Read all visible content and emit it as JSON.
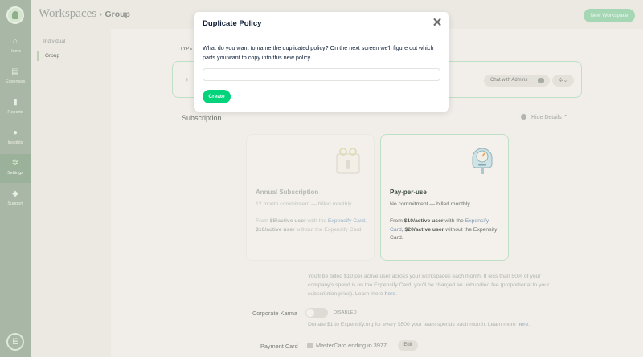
{
  "nav": {
    "items": [
      {
        "label": "Home",
        "icon": "house-icon"
      },
      {
        "label": "Expenses",
        "icon": "receipt-icon"
      },
      {
        "label": "Reports",
        "icon": "document-icon"
      },
      {
        "label": "Insights",
        "icon": "lightbulb-icon"
      },
      {
        "label": "Settings",
        "icon": "gear-icon"
      },
      {
        "label": "Support",
        "icon": "chat-bubble-icon"
      }
    ],
    "active": "Settings",
    "logo_letter": "E"
  },
  "header": {
    "section": "Workspaces",
    "current": "Group",
    "new_workspace_label": "New Workspace"
  },
  "subnav": {
    "items": [
      "Individual",
      "Group"
    ],
    "active": "Group"
  },
  "policy": {
    "type_label": "TYPE",
    "chat_label": "Chat with Admins"
  },
  "subscription": {
    "title": "Subscription",
    "hide_details": "Hide Details",
    "annual": {
      "title": "Annual Subscription",
      "commitment": "12 month commitment — billed monthly",
      "price_prefix": "From ",
      "price_bold": "$5/active user",
      "price_mid": " with the ",
      "card_link": "Expensify Card",
      "price_bold2": "$10/active user",
      "price_suffix": "without the Expensify Card."
    },
    "ppu": {
      "title": "Pay-per-use",
      "commitment": "No commitment — billed monthly",
      "price_prefix": "From ",
      "price_bold": "$10/active user",
      "price_mid": " with the ",
      "card_link": "Expensify Card",
      "price_bold2": "$20/active user",
      "price_suffix": "without the Expensify Card."
    },
    "billing_text": "You'll be billed $10 per active user across your workspaces each month. If less than 50% of your company's spend is on the Expensify Card, you'll be charged an unbundled fee (proportional to your subscription price). Learn more",
    "billing_link": "here"
  },
  "karma": {
    "label": "Corporate Karma",
    "state": "DISABLED",
    "text": "Donate $1 to Expensify.org for every $500 your team spends each month. Learn more",
    "link": "here"
  },
  "payment": {
    "label": "Payment Card",
    "card": "MasterCard ending in 3977",
    "edit_label": "Edit"
  },
  "modal": {
    "title": "Duplicate Policy",
    "close_glyph": "✕",
    "text": "What do you want to name the duplicated policy? On the next screen we'll figure out which parts you want to copy into this new policy.",
    "input_value": "",
    "input_placeholder": "",
    "create_label": "Create"
  },
  "colors": {
    "accent_green": "#03d47c",
    "text_dark": "#0b1b34"
  }
}
